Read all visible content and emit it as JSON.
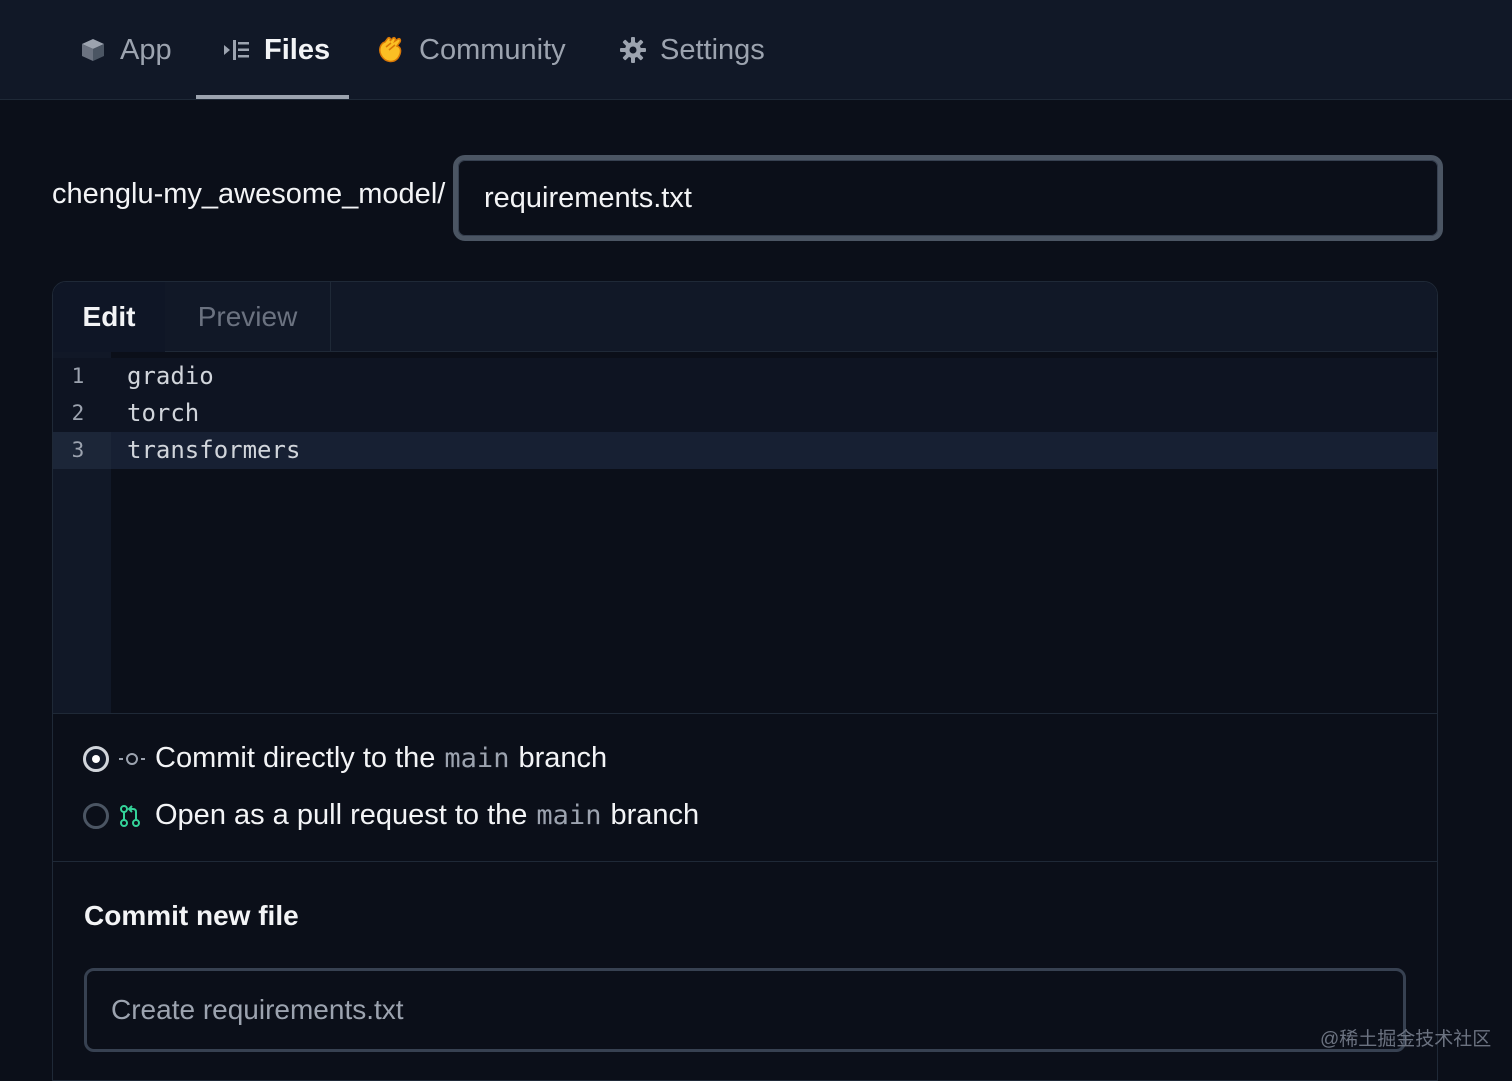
{
  "nav": {
    "tabs": [
      {
        "label": "App",
        "icon": "cube-icon"
      },
      {
        "label": "Files",
        "icon": "file-list-icon",
        "active": true
      },
      {
        "label": "Community",
        "icon": "clapping-hands-icon"
      },
      {
        "label": "Settings",
        "icon": "gear-icon"
      }
    ]
  },
  "path": {
    "repo_prefix": "chenglu-my_awesome_model/",
    "filename_value": "requirements.txt"
  },
  "editor": {
    "tabs": {
      "edit": "Edit",
      "preview": "Preview"
    },
    "lines": [
      {
        "number": "1",
        "text": "gradio"
      },
      {
        "number": "2",
        "text": "torch"
      },
      {
        "number": "3",
        "text": "transformers"
      }
    ]
  },
  "commit_options": {
    "direct": {
      "prefix": "Commit directly to the",
      "branch": "main",
      "suffix": "branch",
      "selected": true,
      "icon": "commit-icon"
    },
    "pull_request": {
      "prefix": "Open as a pull request to the",
      "branch": "main",
      "suffix": "branch",
      "selected": false,
      "icon": "pull-request-icon"
    }
  },
  "commit": {
    "title": "Commit new file",
    "message_placeholder": "Create requirements.txt"
  },
  "watermark": "@稀土掘金技术社区",
  "colors": {
    "background": "#0b0f19",
    "nav_background": "#111827",
    "pr_icon": "#34d399",
    "clap_icon": "#fbbf24"
  }
}
